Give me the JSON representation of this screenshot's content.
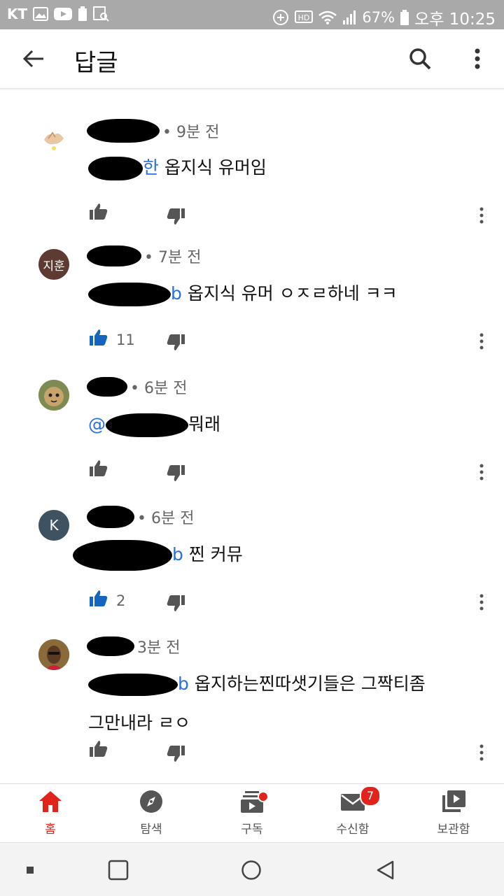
{
  "status_bar": {
    "carrier": "KT",
    "battery": "67%",
    "time": "오후 10:25"
  },
  "app_bar": {
    "title": "답글",
    "back_icon": "arrow-back-icon",
    "search_icon": "search-icon",
    "more_icon": "more-vert-icon"
  },
  "comments": [
    {
      "time": "• 9분 전",
      "mention_suffix": "한",
      "text": "옵지식 유머임",
      "likes": "",
      "avatar_text": ""
    },
    {
      "time": "• 7분 전",
      "mention_suffix": "b",
      "text": "옵지식 유머 ㅇㅈㄹ하네 ㅋㅋ",
      "likes": "11",
      "avatar_text": "지훈"
    },
    {
      "time": "• 6분 전",
      "mention_suffix": "@",
      "text": "뭐래",
      "likes": "",
      "avatar_text": ""
    },
    {
      "time": "• 6분 전",
      "mention_suffix": "b",
      "text": "찐 커뮤",
      "likes": "2",
      "avatar_text": "K"
    },
    {
      "time": "3분 전",
      "mention_suffix": "b",
      "text": "옵지하는찐따샛기들은 그짝티좀",
      "text2": "그만내라 ㄹㅇ",
      "likes": "",
      "avatar_text": ""
    }
  ],
  "bottom_nav": [
    {
      "label": "홈",
      "icon": "home-icon",
      "active": true
    },
    {
      "label": "탐색",
      "icon": "explore-compass-icon"
    },
    {
      "label": "구독",
      "icon": "subscriptions-icon"
    },
    {
      "label": "수신함",
      "icon": "inbox-mail-icon",
      "badge": "7"
    },
    {
      "label": "보관함",
      "icon": "library-icon"
    }
  ],
  "colors": {
    "accent_red": "#e0241b",
    "mention_blue": "#2a6fdb",
    "like_active_blue": "#1565c0"
  }
}
